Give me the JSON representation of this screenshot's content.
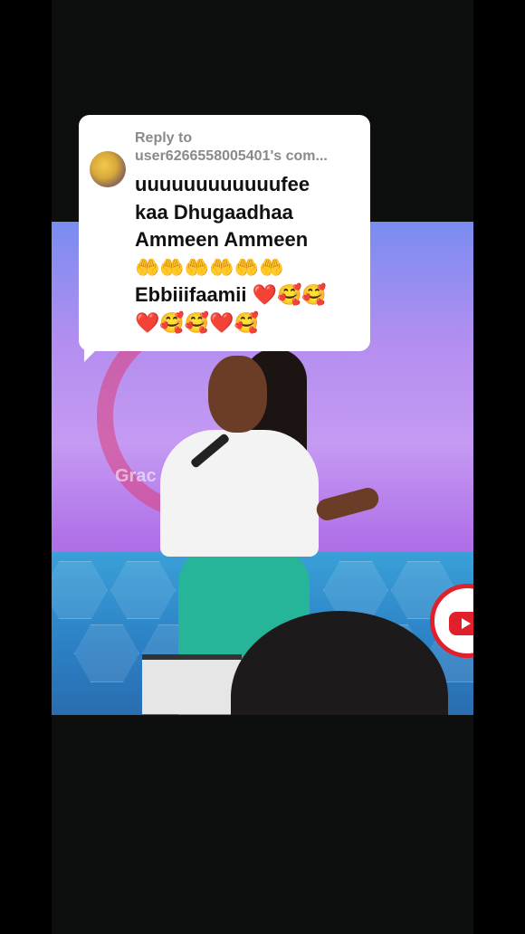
{
  "reply": {
    "label": "Reply to",
    "username": "user6266558005401's com...",
    "comment_lines": [
      "uuuuuuuuuuuufee",
      "kaa Dhugaadhaa",
      "Ammeen Ammeen",
      "🤲🤲🤲🤲🤲🤲",
      "Ebbiiifaamii ❤️🥰🥰",
      "❤️🥰🥰❤️🥰"
    ]
  },
  "video": {
    "watermark_text": "Grac",
    "badge_icon": "youtube-icon",
    "colors": {
      "stage_purple": "#b48ef0",
      "stage_floor": "#2b7fc4",
      "youtube_red": "#e0202a"
    }
  }
}
